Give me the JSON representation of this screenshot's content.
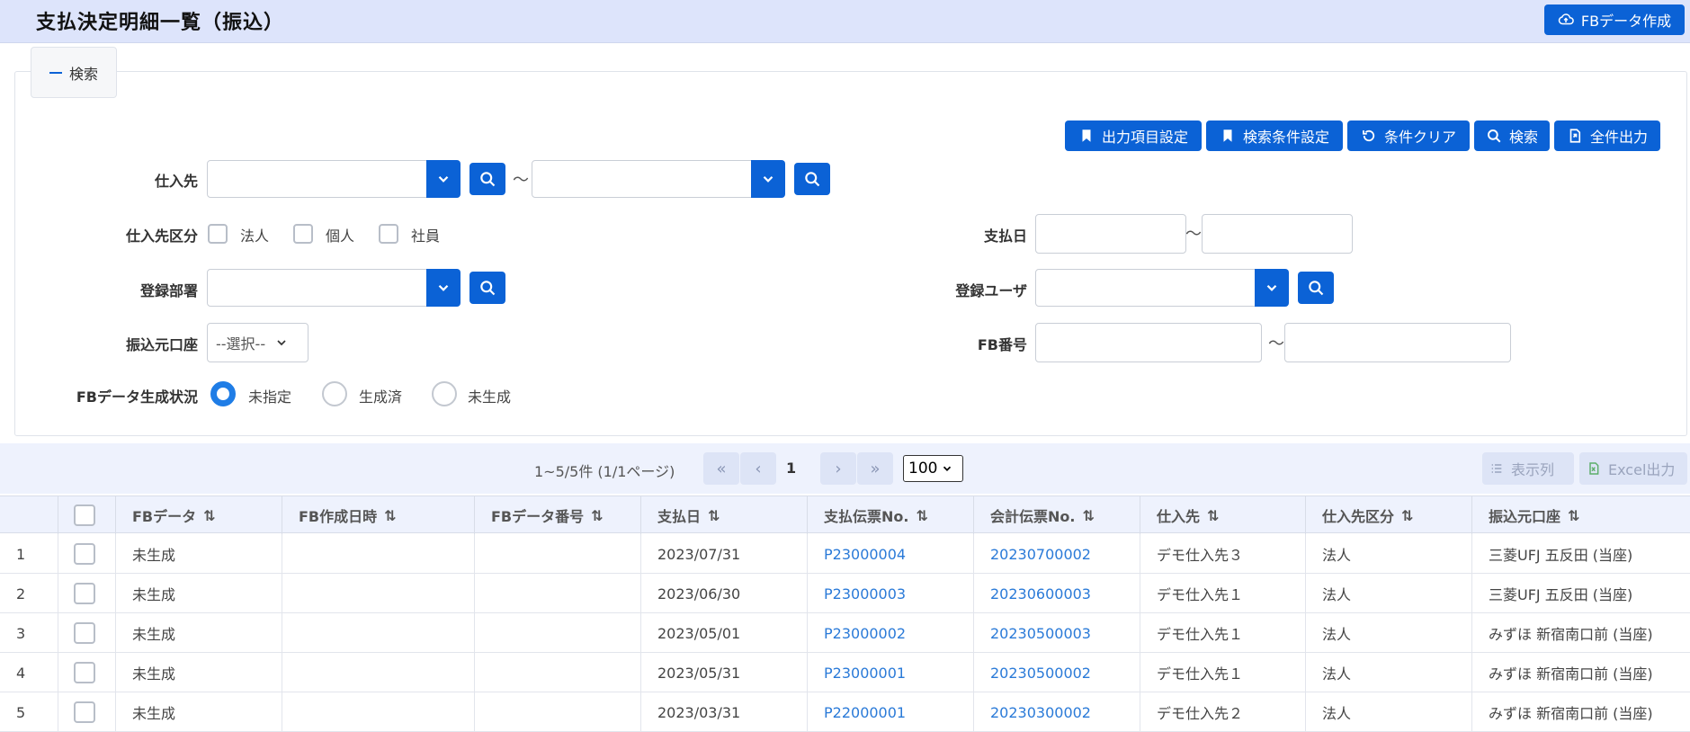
{
  "header": {
    "title": "支払決定明細一覧（振込）",
    "fb_create_label": "FBデータ作成"
  },
  "search": {
    "legend": "検索",
    "buttons": {
      "output_items": "出力項目設定",
      "search_conditions": "検索条件設定",
      "clear": "条件クリア",
      "search": "検索",
      "export_all": "全件出力"
    },
    "supplier_label": "仕入先",
    "supplier_type_label": "仕入先区分",
    "supplier_type_options": [
      "法人",
      "個人",
      "社員"
    ],
    "dept_label": "登録部署",
    "account_label": "振込元口座",
    "account_select": "--選択--",
    "fb_status_label": "FBデータ生成状況",
    "fb_status_options": [
      "未指定",
      "生成済",
      "未生成"
    ],
    "fb_status_selected": "未指定",
    "pay_date_label": "支払日",
    "user_label": "登録ユーザ",
    "fb_number_label": "FB番号",
    "tilde": "～"
  },
  "pager": {
    "info": "1~5/5件 (1/1ページ)",
    "current_page": "1",
    "page_size": "100",
    "columns_label": "表示列",
    "excel_label": "Excel出力"
  },
  "table": {
    "columns": [
      "FBデータ",
      "FB作成日時",
      "FBデータ番号",
      "支払日",
      "支払伝票No.",
      "会計伝票No.",
      "仕入先",
      "仕入先区分",
      "振込元口座"
    ],
    "rows": [
      {
        "no": "1",
        "fb": "未生成",
        "fb_date": "",
        "fb_no": "",
        "pay_date": "2023/07/31",
        "pay_slip": "P23000004",
        "acct_slip": "20230700002",
        "supplier": "デモ仕入先３",
        "type": "法人",
        "account": "三菱UFJ 五反田 (当座)"
      },
      {
        "no": "2",
        "fb": "未生成",
        "fb_date": "",
        "fb_no": "",
        "pay_date": "2023/06/30",
        "pay_slip": "P23000003",
        "acct_slip": "20230600003",
        "supplier": "デモ仕入先１",
        "type": "法人",
        "account": "三菱UFJ 五反田 (当座)"
      },
      {
        "no": "3",
        "fb": "未生成",
        "fb_date": "",
        "fb_no": "",
        "pay_date": "2023/05/01",
        "pay_slip": "P23000002",
        "acct_slip": "20230500003",
        "supplier": "デモ仕入先１",
        "type": "法人",
        "account": "みずほ 新宿南口前 (当座)"
      },
      {
        "no": "4",
        "fb": "未生成",
        "fb_date": "",
        "fb_no": "",
        "pay_date": "2023/05/31",
        "pay_slip": "P23000001",
        "acct_slip": "20230500002",
        "supplier": "デモ仕入先１",
        "type": "法人",
        "account": "みずほ 新宿南口前 (当座)"
      },
      {
        "no": "5",
        "fb": "未生成",
        "fb_date": "",
        "fb_no": "",
        "pay_date": "2023/03/31",
        "pay_slip": "P22000001",
        "acct_slip": "20230300002",
        "supplier": "デモ仕入先２",
        "type": "法人",
        "account": "みずほ 新宿南口前 (当座)"
      }
    ]
  },
  "colors": {
    "primary": "#0b62d6",
    "header_bg": "#dde4fb",
    "link": "#2a7ad8",
    "radio_on": "#1f7de6"
  },
  "icons": {
    "fb_create": "cloud-upload-icon",
    "bookmark": "bookmark-icon",
    "clear": "rotate-left-icon",
    "search": "search-icon",
    "export": "file-export-icon",
    "dropdown": "chevron-down-icon",
    "columns": "list-icon",
    "excel": "excel-icon",
    "sort": "sort-icon"
  }
}
